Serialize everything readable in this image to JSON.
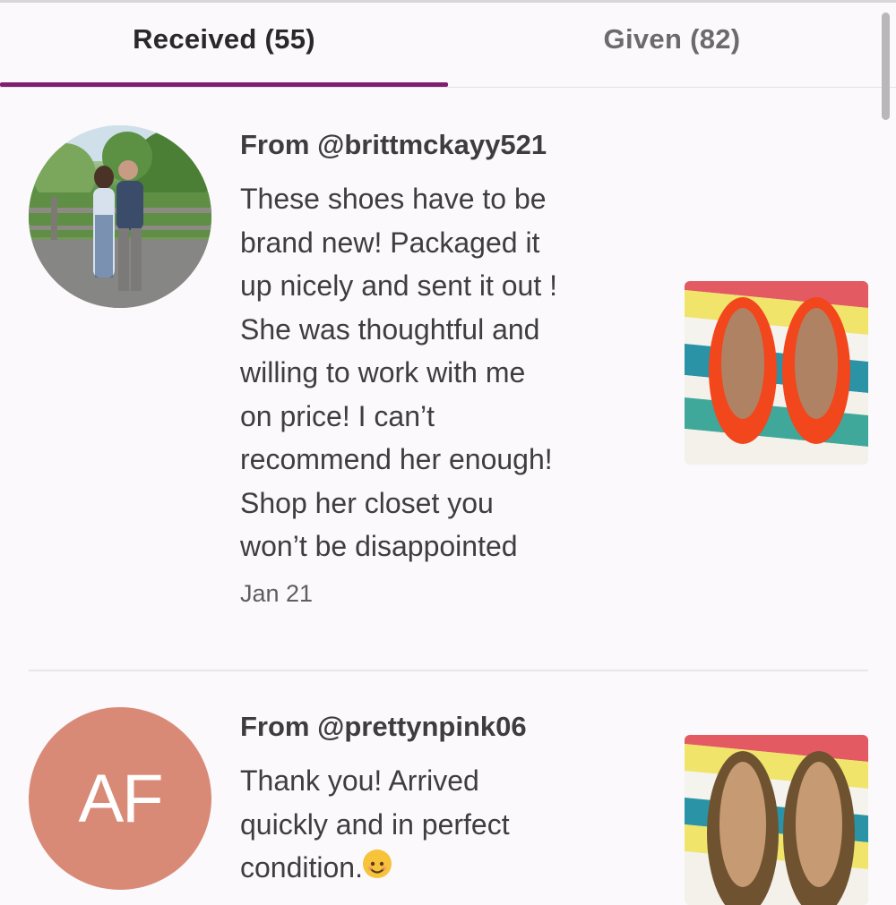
{
  "tabs": {
    "received": "Received (55)",
    "given": "Given (82)"
  },
  "reviews": [
    {
      "from": "From @brittmckayy521",
      "text": "These shoes have to be\nbrand new! Packaged it\nup nicely and sent it out !\nShe was thoughtful and\nwilling to work with me\non price! I can’t\nrecommend her enough!\nShop her closet you\nwon’t be disappointed",
      "date": "Jan 21",
      "avatar": "photo",
      "product_color": "#f0501c"
    },
    {
      "from": "From @prettynpink06",
      "text": "Thank you! Arrived\nquickly and in perfect\ncondition.",
      "emoji": "smiling-face-icon",
      "avatar_initials": "AF",
      "avatar_color": "#d98a77",
      "product_color": "#7a5a34"
    }
  ],
  "colors": {
    "accent": "#7f1f6e",
    "background": "#fbf9fb"
  }
}
